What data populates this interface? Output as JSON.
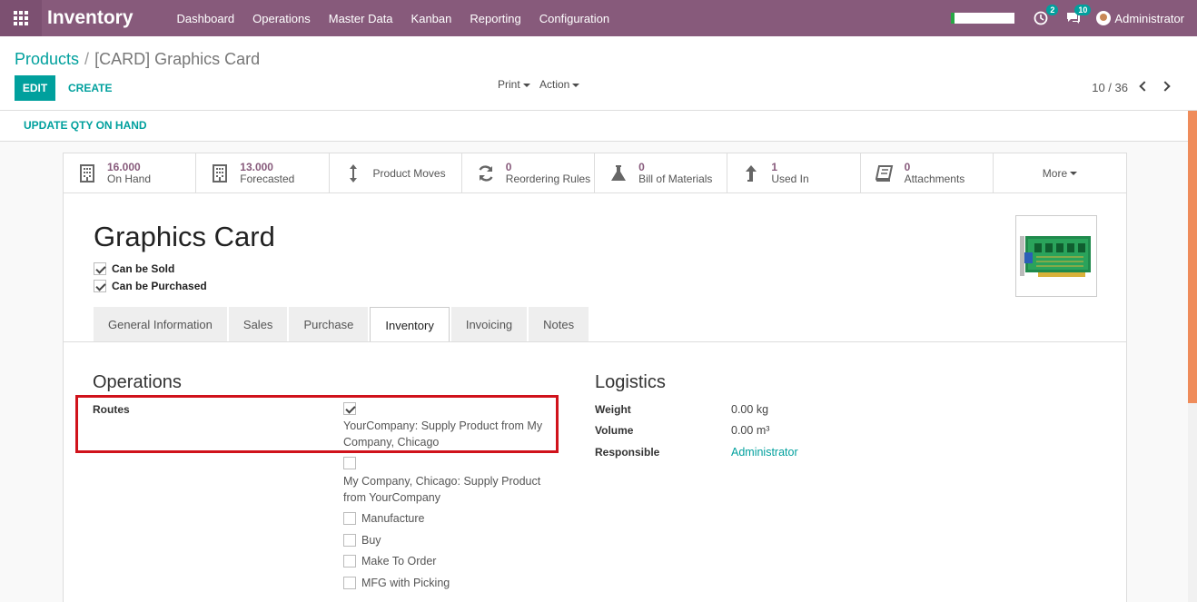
{
  "app": {
    "title": "Inventory"
  },
  "menu": [
    "Dashboard",
    "Operations",
    "Master Data",
    "Kanban",
    "Reporting",
    "Configuration"
  ],
  "systray": {
    "activity_count": "2",
    "messages_count": "10",
    "user_name": "Administrator"
  },
  "breadcrumb": {
    "parent": "Products",
    "separator": "/",
    "current": "[CARD] Graphics Card"
  },
  "buttons": {
    "edit": "EDIT",
    "create": "CREATE",
    "print": "Print",
    "action": "Action",
    "update_qty": "UPDATE QTY ON HAND"
  },
  "pager": {
    "value": "10 / 36"
  },
  "stat_buttons": [
    {
      "value": "16.000",
      "label": "On Hand",
      "icon": "building-icon"
    },
    {
      "value": "13.000",
      "label": "Forecasted",
      "icon": "building-icon"
    },
    {
      "value": "",
      "label": "Product Moves",
      "icon": "arrows-vertical-icon"
    },
    {
      "value": "0",
      "label": "Reordering Rules",
      "icon": "refresh-icon"
    },
    {
      "value": "0",
      "label": "Bill of Materials",
      "icon": "flask-icon"
    },
    {
      "value": "1",
      "label": "Used In",
      "icon": "level-up-icon"
    },
    {
      "value": "0",
      "label": "Attachments",
      "icon": "book-icon"
    },
    {
      "value": "",
      "label": "More",
      "icon": "caret-down-icon"
    }
  ],
  "product": {
    "name": "Graphics Card",
    "can_be_sold": "Can be Sold",
    "can_be_purchased": "Can be Purchased"
  },
  "tabs": [
    "General Information",
    "Sales",
    "Purchase",
    "Inventory",
    "Invoicing",
    "Notes"
  ],
  "active_tab": "Inventory",
  "operations": {
    "title": "Operations",
    "routes_label": "Routes",
    "routes": [
      {
        "label": "YourCompany: Supply Product from My Company, Chicago",
        "checked": true
      },
      {
        "label": "My Company, Chicago: Supply Product from YourCompany",
        "checked": false
      },
      {
        "label": "Manufacture",
        "checked": false
      },
      {
        "label": "Buy",
        "checked": false
      },
      {
        "label": "Make To Order",
        "checked": false
      },
      {
        "label": "MFG with Picking",
        "checked": false
      }
    ]
  },
  "logistics": {
    "title": "Logistics",
    "weight_label": "Weight",
    "weight_value": "0.00",
    "weight_unit": "kg",
    "volume_label": "Volume",
    "volume_value": "0.00",
    "volume_unit": "m³",
    "responsible_label": "Responsible",
    "responsible_value": "Administrator"
  },
  "colors": {
    "navbar": "#875a7b",
    "accent": "#00a09d",
    "highlight": "#d0121b"
  }
}
